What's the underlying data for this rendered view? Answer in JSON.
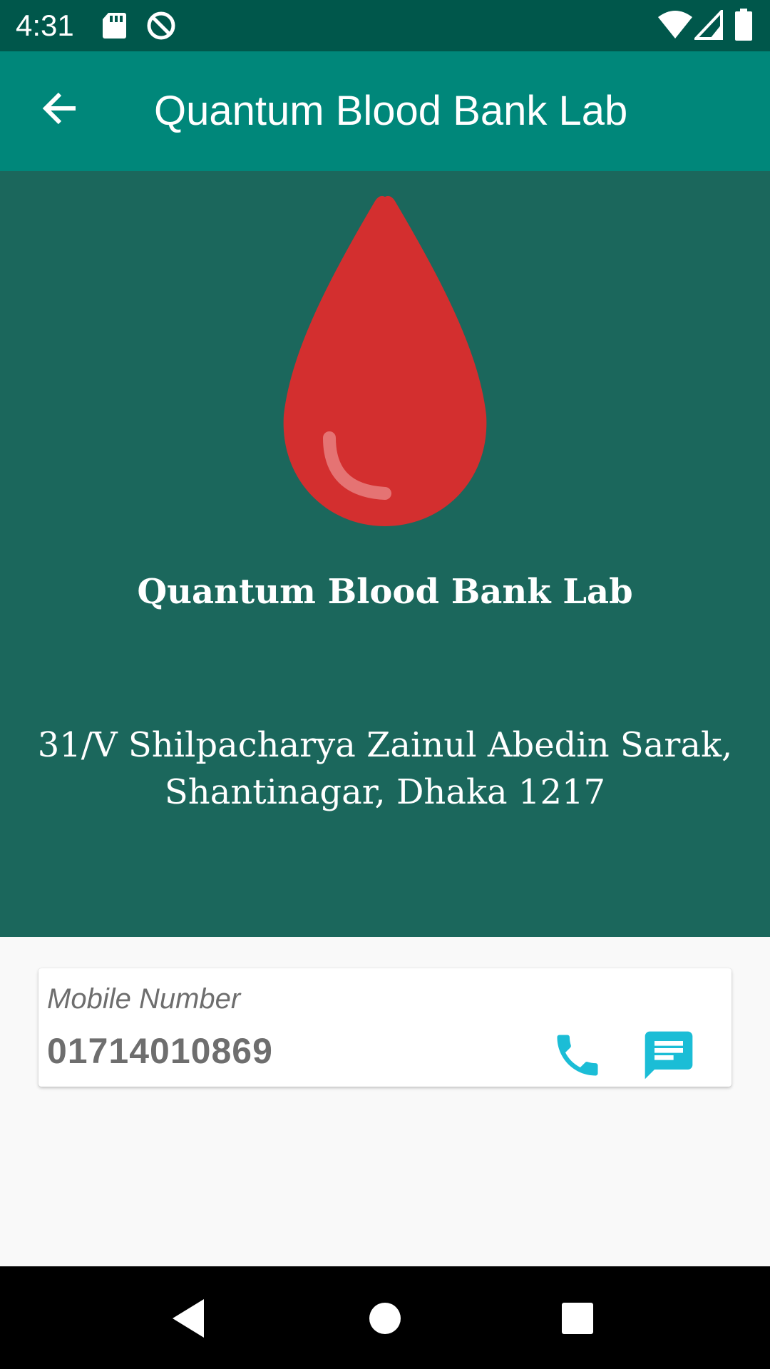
{
  "status_bar": {
    "time": "4:31",
    "icons": [
      "sd-card-icon",
      "do-not-disturb-icon",
      "wifi-icon",
      "cellular-signal-icon",
      "battery-icon"
    ]
  },
  "app_bar": {
    "back_icon": "arrow-back-icon",
    "title": "Quantum Blood Bank Lab"
  },
  "hero": {
    "icon": "blood-drop-icon",
    "name": "Quantum Blood Bank Lab",
    "address": "31/V Shilpacharya Zainul Abedin Sarak, Shantinagar, Dhaka 1217"
  },
  "contact": {
    "label": "Mobile Number",
    "number": "01714010869",
    "call_icon": "phone-icon",
    "message_icon": "message-icon"
  },
  "nav_bar": {
    "buttons": [
      "back",
      "home",
      "recents"
    ]
  },
  "colors": {
    "status_bar": "#00574b",
    "app_bar": "#00877a",
    "hero_background": "#1b675c",
    "blood_drop": "#d32f2f",
    "accent": "#1bbdd6",
    "page_background": "#f9f9f9",
    "nav_bar": "#000000"
  }
}
